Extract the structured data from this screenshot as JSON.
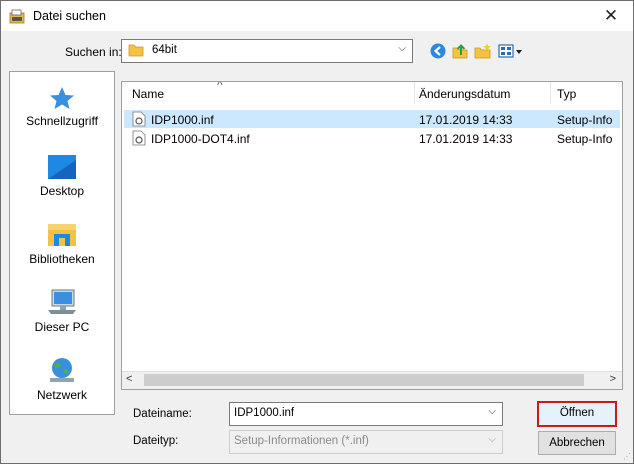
{
  "window": {
    "title": "Datei suchen",
    "close_glyph": "✕"
  },
  "lookin": {
    "label": "Suchen in:",
    "value": "64bit",
    "arrow": "⌵"
  },
  "toolbar": {
    "icons": [
      "back-icon",
      "up-folder-icon",
      "new-folder-icon",
      "view-menu-icon"
    ]
  },
  "places": [
    {
      "label": "Schnellzugriff",
      "icon": "star-icon"
    },
    {
      "label": "Desktop",
      "icon": "desktop-icon"
    },
    {
      "label": "Bibliotheken",
      "icon": "library-icon"
    },
    {
      "label": "Dieser PC",
      "icon": "computer-icon"
    },
    {
      "label": "Netzwerk",
      "icon": "network-icon"
    }
  ],
  "filelist": {
    "sort_caret": "^",
    "columns": {
      "name": "Name",
      "date": "Änderungsdatum",
      "type": "Typ"
    },
    "rows": [
      {
        "name": "IDP1000.inf",
        "date": "17.01.2019 14:33",
        "type": "Setup-Info",
        "selected": true
      },
      {
        "name": "IDP1000-DOT4.inf",
        "date": "17.01.2019 14:33",
        "type": "Setup-Info",
        "selected": false
      }
    ],
    "scroll_left": "<",
    "scroll_right": ">"
  },
  "filename": {
    "label": "Dateiname:",
    "value": "IDP1000.inf",
    "arrow": "⌵"
  },
  "filetype": {
    "label": "Dateityp:",
    "value": "Setup-Informationen (*.inf)",
    "arrow": "⌵"
  },
  "buttons": {
    "open": "Öffnen",
    "cancel": "Abbrechen"
  },
  "colors": {
    "selection": "#cce8ff",
    "open_button_border": "#cc1a1a",
    "folder": "#f5c242"
  }
}
